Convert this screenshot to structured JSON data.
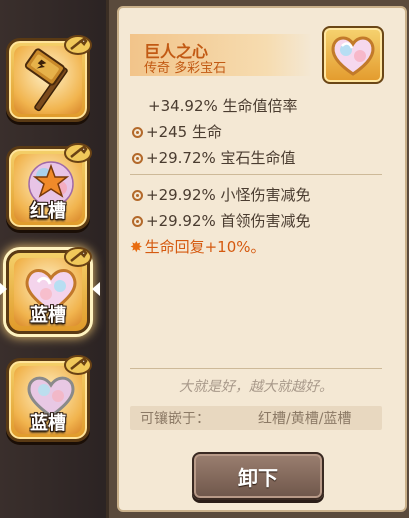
{
  "slots": [
    {
      "label": "",
      "icon": "hammer-icon"
    },
    {
      "label": "红槽",
      "icon": "gem-star-icon"
    },
    {
      "label": "蓝槽",
      "icon": "heart-gem-icon"
    },
    {
      "label": "蓝槽",
      "icon": "heart-gem-icon"
    }
  ],
  "item": {
    "name": "巨人之心",
    "rarity_type": "传奇 多彩宝石",
    "icon": "heart-gem-icon"
  },
  "stats_main": [
    "+34.92% 生命值倍率",
    "+245 生命",
    "+29.72% 宝石生命值"
  ],
  "stats_secondary": [
    "+29.92% 小怪伤害减免",
    "+29.92% 首领伤害减免"
  ],
  "special": "生命回复+10%。",
  "flavor": "大就是好，越大就越好。",
  "compat_label": "可镶嵌于：",
  "compat_value": "红槽/黄槽/蓝槽",
  "unequip_label": "卸下",
  "colors": {
    "title": "#c25a14",
    "special": "#d55a10",
    "panel_bg": "#f4e8d4",
    "slot_gold": "#f1b44e"
  }
}
